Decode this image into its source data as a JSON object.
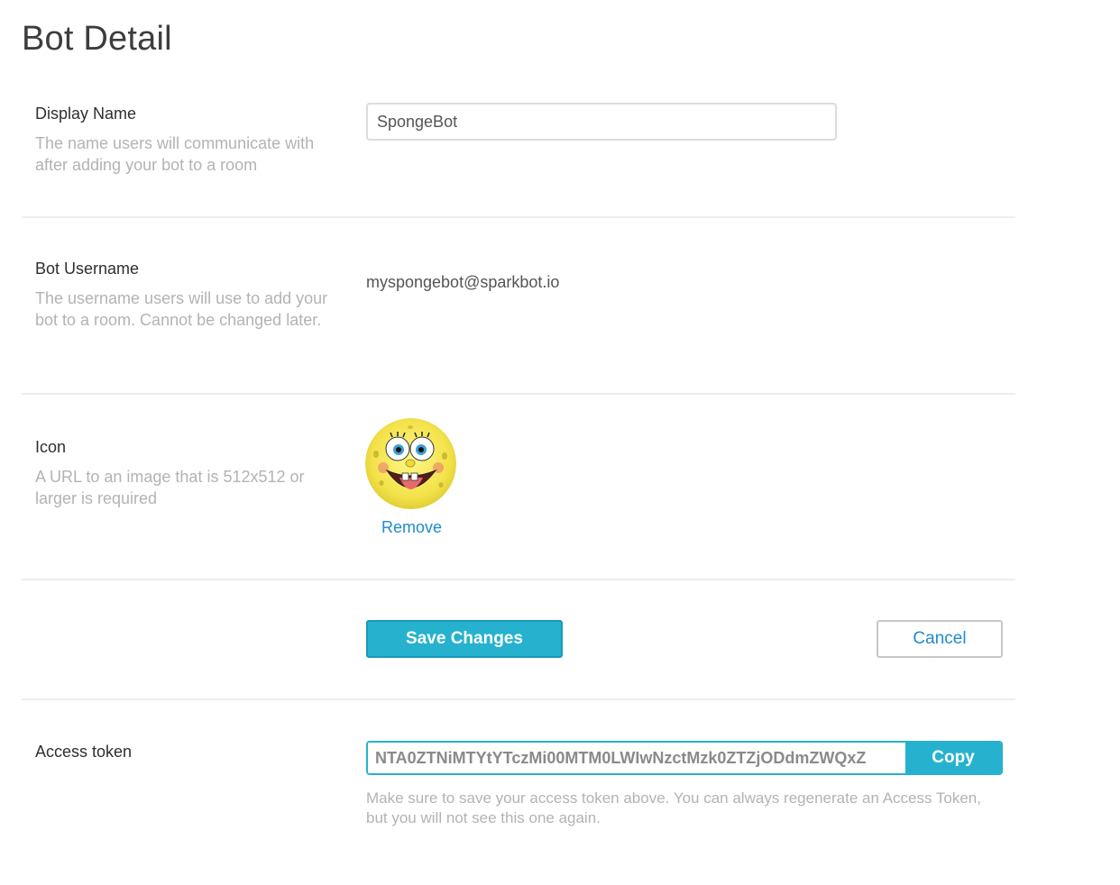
{
  "page": {
    "title": "Bot Detail"
  },
  "display_name": {
    "label": "Display Name",
    "description": "The name users will communicate with after adding your bot to a room",
    "value": "SpongeBot"
  },
  "bot_username": {
    "label": "Bot Username",
    "description": "The username users will use to add your bot to a room. Cannot be changed later.",
    "value": "myspongebot@sparkbot.io"
  },
  "icon_section": {
    "label": "Icon",
    "description": "A URL to an image that is 512x512 or larger is required",
    "image_alt": "spongebob-avatar",
    "remove_label": "Remove"
  },
  "actions": {
    "save_label": "Save Changes",
    "cancel_label": "Cancel"
  },
  "access_token": {
    "label": "Access token",
    "value": "NTA0ZTNiMTYtYTczMi00MTM0LWIwNzctMzk0ZTZjODdmZWQxZ",
    "copy_label": "Copy",
    "note": "Make sure to save your access token above. You can always regenerate an Access Token, but you will not see this one again."
  },
  "colors": {
    "accent": "#26b2cf",
    "link": "#1e8bd0",
    "muted_text": "#b3b3b3",
    "divider": "#ededed"
  }
}
